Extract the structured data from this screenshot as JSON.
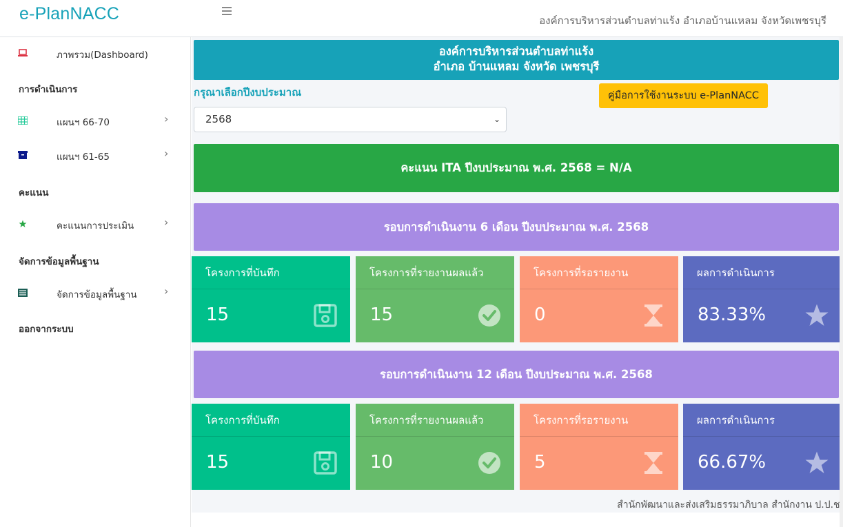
{
  "header": {
    "brand": "e-PlanNACC",
    "org_name": "องค์การบริหารส่วนตำบลท่าแร้ง อำเภอบ้านแหลม จังหวัดเพชรบุรี"
  },
  "sidebar": {
    "dashboard": "ภาพรวม(Dashboard)",
    "section_operations": "การดำเนินการ",
    "plan_66_70": "แผนฯ 66-70",
    "plan_61_65": "แผนฯ 61-65",
    "section_score": "คะแนน",
    "eval_score": "คะแนนการประเมิน",
    "section_basic": "จัดการข้อมูลพื้นฐาน",
    "basic_data": "จัดการข้อมูลพื้นฐาน",
    "logout": "ออกจากระบบ"
  },
  "main": {
    "org_line1": "องค์การบริหารส่วนตำบลท่าแร้ง",
    "org_line2": "อำเภอ บ้านแหลม จังหวัด เพชรบุรี",
    "year_label": "กรุณาเลือกปีงบประมาณ",
    "manual_button": "คู่มือการใช้งานระบบ e-PlanNACC",
    "selected_year": "2568",
    "ita_text": "คะแนน ITA ปีงบประมาณ พ.ศ. 2568 = N/A",
    "round6_title": "รอบการดำเนินงาน 6 เดือน ปีงบประมาณ พ.ศ. 2568",
    "round12_title": "รอบการดำเนินงาน 12 เดือน ปีงบประมาณ พ.ศ. 2568",
    "round6": {
      "recorded_label": "โครงการที่บันทึก",
      "recorded_value": "15",
      "reported_label": "โครงการที่รายงานผลแล้ว",
      "reported_value": "15",
      "pending_label": "โครงการที่รอรายงาน",
      "pending_value": "0",
      "result_label": "ผลการดำเนินการ",
      "result_value": "83.33%"
    },
    "round12": {
      "recorded_label": "โครงการที่บันทึก",
      "recorded_value": "15",
      "reported_label": "โครงการที่รายงานผลแล้ว",
      "reported_value": "10",
      "pending_label": "โครงการที่รอรายงาน",
      "pending_value": "5",
      "result_label": "ผลการดำเนินการ",
      "result_value": "66.67%"
    },
    "footer": "สำนักพัฒนาและส่งเสริมธรรมาภิบาล สำนักงาน ป.ป.ช."
  },
  "colors": {
    "brand": "#17a2b8",
    "ita": "#28a745",
    "round": "#a78be4",
    "teal": "#00c08b",
    "green": "#66bb6a",
    "salmon": "#fc9878",
    "indigo": "#5c6bc0",
    "manual": "#ffc107"
  },
  "icons": {
    "dashboard": "laptop-icon",
    "plan_66_70": "table-icon",
    "plan_61_65": "archive-icon",
    "eval_score": "star-icon",
    "basic_data": "list-icon",
    "recorded": "floppy-disk-icon",
    "reported": "check-circle-icon",
    "pending": "hourglass-icon",
    "result": "star-icon"
  }
}
